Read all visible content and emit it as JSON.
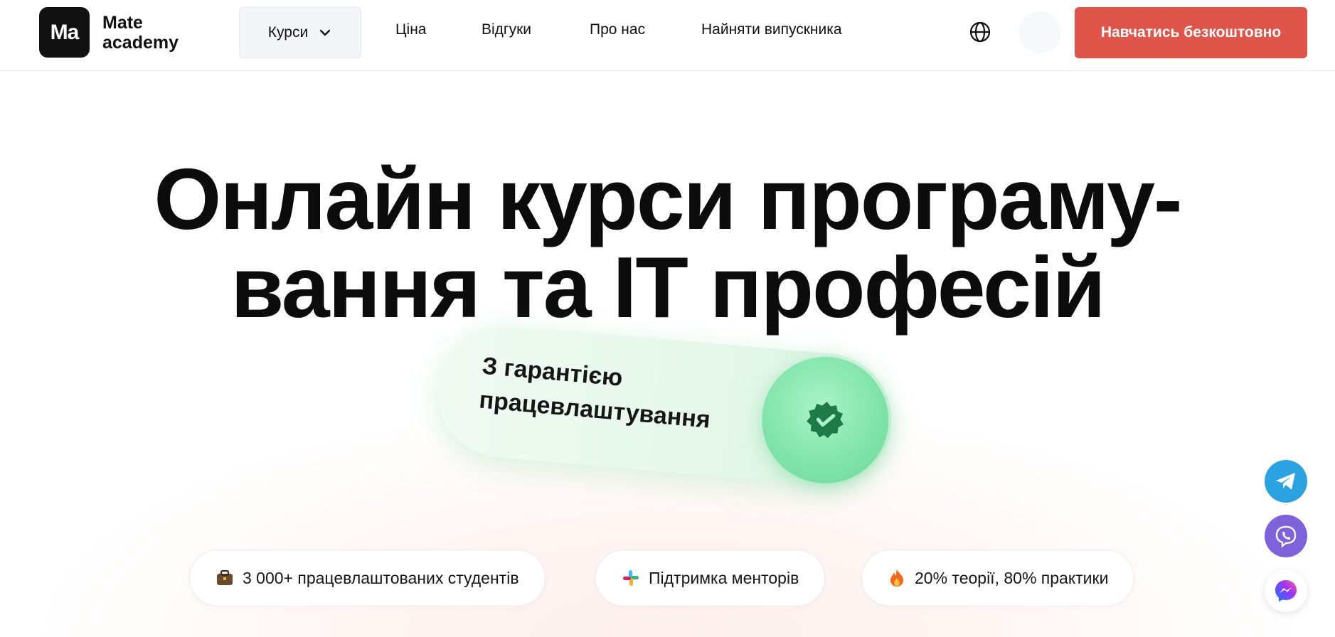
{
  "header": {
    "logo_mark": "Ma",
    "logo_line1": "Mate",
    "logo_line2": "academy",
    "nav": {
      "courses": "Курси",
      "price": "Ціна",
      "reviews": "Відгуки",
      "about": "Про нас",
      "hire": "Найняти випускника"
    },
    "cta": "Навчатись безкоштовно"
  },
  "hero": {
    "title_line1": "Онлайн курси програму-",
    "title_line2": "вання та IT професій",
    "badge_line1": "З гарантією",
    "badge_line2": "працевлаштування"
  },
  "features": [
    {
      "icon": "briefcase-icon",
      "label": "3 000+ працевлаштованих студентів"
    },
    {
      "icon": "slack-icon",
      "label": "Підтримка менторів"
    },
    {
      "icon": "fire-icon",
      "label": "20% теорії, 80% практики"
    }
  ],
  "socials": [
    "telegram-icon",
    "viber-icon",
    "messenger-icon"
  ],
  "colors": {
    "cta": "#e0554a",
    "badge_green": "#7ee3a8",
    "telegram": "#2ba3e3",
    "viber": "#7d62d9"
  }
}
